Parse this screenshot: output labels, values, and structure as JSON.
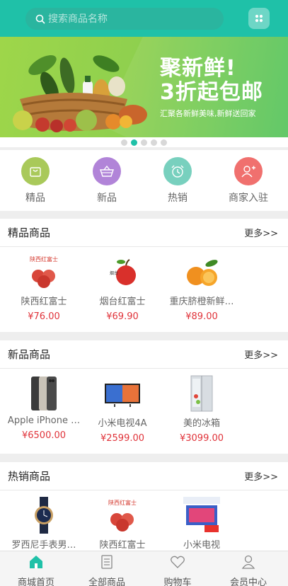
{
  "search": {
    "placeholder": "搜索商品名称"
  },
  "banner": {
    "title_line1": "聚新鲜!",
    "title_line2": "3折起包邮",
    "subtitle": "汇聚各新鲜美味,新鲜送回家"
  },
  "carousel": {
    "count": 5,
    "active_index": 1
  },
  "categories": [
    {
      "label": "精品",
      "icon": "shopping-bag-icon",
      "color": "#a9c95a"
    },
    {
      "label": "新品",
      "icon": "basket-icon",
      "color": "#b184d8"
    },
    {
      "label": "热销",
      "icon": "alarm-clock-icon",
      "color": "#78d0be"
    },
    {
      "label": "商家入驻",
      "icon": "user-add-icon",
      "color": "#f0706e"
    }
  ],
  "sections": [
    {
      "title": "精品商品",
      "more": "更多>>",
      "items": [
        {
          "name": "陕西红富士",
          "price": "¥76.00",
          "image": "apple-box-image"
        },
        {
          "name": "烟台红富士",
          "price": "¥69.90",
          "image": "apple-image"
        },
        {
          "name": "重庆脐橙新鲜…",
          "price": "¥89.00",
          "image": "orange-image"
        }
      ]
    },
    {
      "title": "新品商品",
      "more": "更多>>",
      "items": [
        {
          "name": "Apple iPhone …",
          "price": "¥6500.00",
          "image": "iphone-image"
        },
        {
          "name": "小米电视4A",
          "price": "¥2599.00",
          "image": "tv-image"
        },
        {
          "name": "美的冰箱",
          "price": "¥3099.00",
          "image": "fridge-image"
        }
      ]
    },
    {
      "title": "热销商品",
      "more": "更多>>",
      "items": [
        {
          "name": "罗西尼手表男…",
          "price": "",
          "image": "watch-image"
        },
        {
          "name": "陕西红富士",
          "price": "",
          "image": "apple-box-image"
        },
        {
          "name": "小米电视",
          "price": "",
          "image": "tv-ad-image"
        }
      ]
    }
  ],
  "tabbar": [
    {
      "label": "商城首页",
      "icon": "home-icon",
      "active": true
    },
    {
      "label": "全部商品",
      "icon": "list-icon",
      "active": false
    },
    {
      "label": "购物车",
      "icon": "heart-icon",
      "active": false
    },
    {
      "label": "会员中心",
      "icon": "user-icon",
      "active": false
    }
  ],
  "colors": {
    "accent": "#1fc1a8",
    "price": "#e0333a"
  }
}
